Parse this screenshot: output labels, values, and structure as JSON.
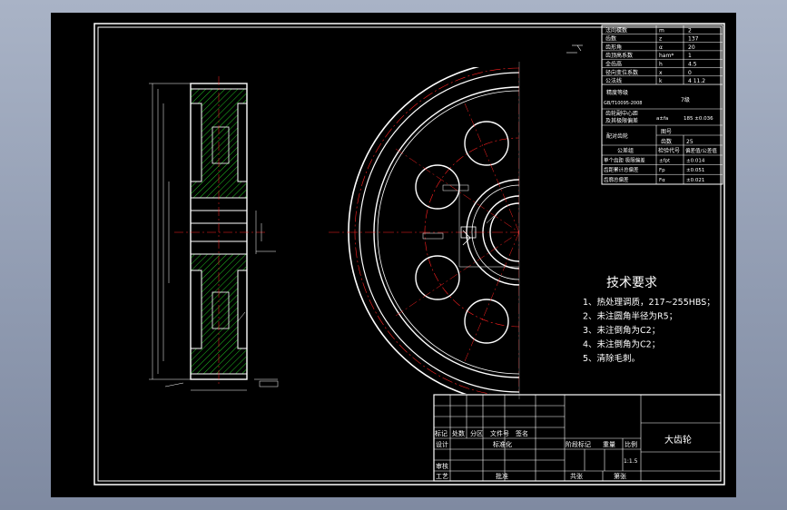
{
  "params_table": [
    {
      "name": "法向模数",
      "sym": "m",
      "val": "2"
    },
    {
      "name": "齿数",
      "sym": "z",
      "val": "137"
    },
    {
      "name": "齿形角",
      "sym": "α",
      "val": "20"
    },
    {
      "name": "齿顶高系数",
      "sym": "ham*",
      "val": "1"
    },
    {
      "name": "全齿高",
      "sym": "h",
      "val": "4.5"
    },
    {
      "name": "径向变位系数",
      "sym": "x",
      "val": "0"
    },
    {
      "name": "公法线",
      "sym": "k",
      "val": "4 11.2"
    }
  ],
  "params_extra": {
    "accuracy_label": "精度等级",
    "accuracy_std": "GB/T10095-2008",
    "accuracy_val": "7级",
    "center_label": "齿轮副中心距",
    "center_label2": "及其极限偏差",
    "center_sym": "a±fa",
    "center_val": "185 ±0.036",
    "mate_label": "配对齿轮",
    "mate_num_label": "图号",
    "mate_teeth_label": "齿数",
    "mate_teeth_val": "25",
    "check_h1": "公差组",
    "check_h2": "检验代号",
    "check_h3": "偏差值/公差值",
    "check_rows": [
      {
        "name": "单个齿距 极限偏差",
        "sym": "±fpt",
        "val": "±0.014"
      },
      {
        "name": "齿距累计总偏差",
        "sym": "Fp",
        "val": "±0.051"
      },
      {
        "name": "齿廓总偏差",
        "sym": "Fα",
        "val": "±0.021"
      }
    ]
  },
  "tech": {
    "title": "技术要求",
    "items": [
      "1、热处理调质，217~255HBS；",
      "2、未注圆角半径为R5；",
      "3、未注倒角为C2；",
      "4、未注倒角为C2；",
      "5、清除毛刺。"
    ]
  },
  "title_block": {
    "part_name": "大齿轮",
    "mark": "标记",
    "count": "处数",
    "zone": "分区",
    "doc_no": "文件号",
    "sign": "签名",
    "design": "设计",
    "standard": "标准化",
    "stage_mark": "阶段标记",
    "weight": "重量",
    "scale": "比例",
    "scale_val": "1:1.5",
    "review": "审核",
    "process": "工艺",
    "approve": "批准",
    "sheets_total": "共张",
    "sheet_no": "第张"
  },
  "colors": {
    "line": "#ffffff",
    "center": "#ff2020",
    "hatch": "#20c020",
    "dim": "#ffffff",
    "border": "#ffffff"
  }
}
